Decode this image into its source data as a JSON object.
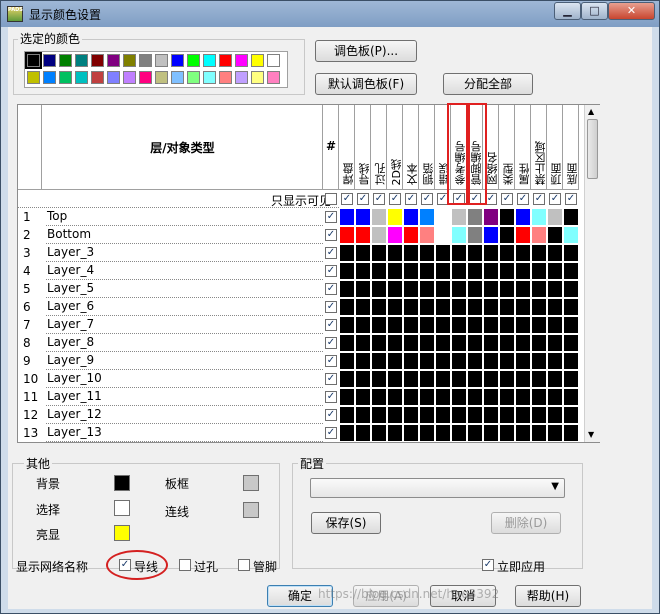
{
  "window": {
    "title": "显示颜色设置"
  },
  "selected_colors": {
    "label": "选定的颜色",
    "row1": [
      "#000000",
      "#000080",
      "#008000",
      "#008080",
      "#800000",
      "#800080",
      "#808000",
      "#808080",
      "#c0c0c0",
      "#0000ff",
      "#00ff00",
      "#00ffff",
      "#ff0000",
      "#ff00ff",
      "#ffff00",
      "#ffffff"
    ],
    "row2": [
      "#c0c000",
      "#0080ff",
      "#00c060",
      "#00c0c0",
      "#c04040",
      "#8080ff",
      "#c080ff",
      "#ff0080",
      "#c0c080",
      "#80c0ff",
      "#80ff80",
      "#80ffff",
      "#ff8080",
      "#c0a0ff",
      "#ffff80",
      "#ff80c0"
    ]
  },
  "buttons": {
    "palette": "调色板(P)...",
    "default_palette": "默认调色板(F)",
    "assign_all": "分配全部",
    "save": "保存(S)",
    "delete": "删除(D)",
    "ok": "确定",
    "apply": "应用(A)",
    "cancel": "取消",
    "help": "帮助(H)"
  },
  "grid": {
    "layer_type_header": "层/对象类型",
    "hash_header": "#",
    "column_headers": [
      "焊盘",
      "导线",
      "过孔",
      "2D线",
      "文本",
      "铜箔",
      "错误",
      "参考编号",
      "管脚编号",
      "网络名",
      "类型",
      "属性",
      "禁止区域",
      "顶面",
      "底面"
    ],
    "only_visible": "只显示可见",
    "rows": [
      {
        "num": "1",
        "name": "Top",
        "colors": [
          "#0000ff",
          "#0000ff",
          "#c0c0c0",
          "#ffff00",
          "#0000ff",
          "#0080ff",
          "#ffffff",
          "#c0c0c0",
          "#808080",
          "#800080",
          "#000000",
          "#0000ff",
          "#80ffff",
          "#c0c0c0",
          "#000000"
        ]
      },
      {
        "num": "2",
        "name": "Bottom",
        "colors": [
          "#ff0000",
          "#ff0000",
          "#c0c0c0",
          "#ff00ff",
          "#ff0000",
          "#ff8080",
          "#ffffff",
          "#80ffff",
          "#808080",
          "#0000ff",
          "#000000",
          "#ff0000",
          "#ff8080",
          "#000000",
          "#80ffff"
        ]
      },
      {
        "num": "3",
        "name": "Layer_3"
      },
      {
        "num": "4",
        "name": "Layer_4"
      },
      {
        "num": "5",
        "name": "Layer_5"
      },
      {
        "num": "6",
        "name": "Layer_6"
      },
      {
        "num": "7",
        "name": "Layer_7"
      },
      {
        "num": "8",
        "name": "Layer_8"
      },
      {
        "num": "9",
        "name": "Layer_9"
      },
      {
        "num": "10",
        "name": "Layer_10"
      },
      {
        "num": "11",
        "name": "Layer_11"
      },
      {
        "num": "12",
        "name": "Layer_12"
      },
      {
        "num": "13",
        "name": "Layer_13"
      }
    ]
  },
  "other": {
    "label": "其他",
    "background": {
      "label": "背景",
      "color": "#000000"
    },
    "selection": {
      "label": "选择",
      "color": "#ffffff"
    },
    "highlight": {
      "label": "亮显",
      "color": "#ffff00"
    },
    "board_frame": {
      "label": "板框",
      "color": "#c8c8c8"
    },
    "connection": {
      "label": "连线",
      "color": "#c8c8c8"
    }
  },
  "config": {
    "label": "配置",
    "selected": ""
  },
  "net_names": {
    "label": "显示网络名称",
    "trace": {
      "label": "导线",
      "checked": true
    },
    "via": {
      "label": "过孔",
      "checked": false
    },
    "pin": {
      "label": "管脚",
      "checked": false
    }
  },
  "apply_immediately": {
    "label": "立即应用",
    "checked": true
  },
  "watermark": "https://blog.csdn.net/hao3392"
}
